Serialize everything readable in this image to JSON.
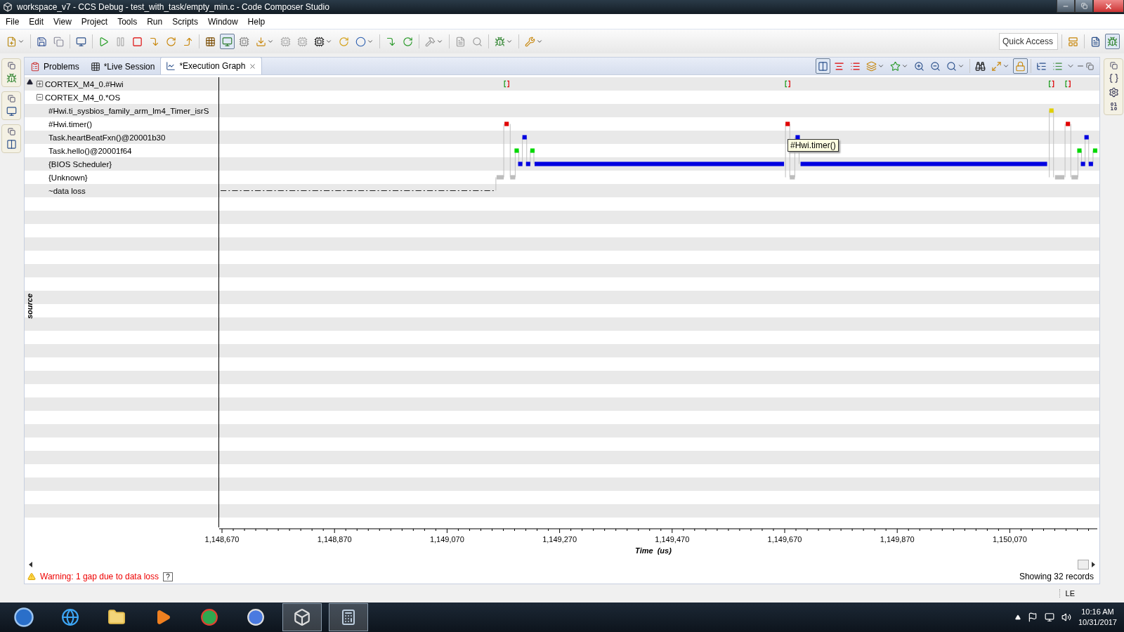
{
  "window": {
    "title": "workspace_v7 - CCS Debug - test_with_task/empty_min.c - Code Composer Studio"
  },
  "menu": [
    "File",
    "Edit",
    "View",
    "Project",
    "Tools",
    "Run",
    "Scripts",
    "Window",
    "Help"
  ],
  "quick_access": {
    "placeholder": "Quick Access"
  },
  "tabs": [
    {
      "label": "Problems",
      "selected": false,
      "kind": "problems",
      "closable": false
    },
    {
      "label": "*Live Session",
      "selected": false,
      "kind": "table",
      "closable": false
    },
    {
      "label": "*Execution Graph",
      "selected": true,
      "kind": "graph",
      "closable": true
    }
  ],
  "axis_label": "source",
  "tree": [
    {
      "label": "CORTEX_M4_0.#Hwi",
      "expanded": false
    },
    {
      "label": "CORTEX_M4_0.*OS",
      "expanded": true,
      "children": [
        {
          "label": "#Hwi.ti_sysbios_family_arm_lm4_Timer_isrS"
        },
        {
          "label": "#Hwi.timer()"
        },
        {
          "label": "Task.heartBeatFxn()@20001b30"
        },
        {
          "label": "Task.hello()@20001f64"
        },
        {
          "label": "{BIOS Scheduler}"
        },
        {
          "label": "{Unknown}"
        },
        {
          "label": "~data loss"
        }
      ]
    }
  ],
  "tooltip": "#Hwi.timer()",
  "time_axis": {
    "ticks": [
      "1,148,670",
      "1,148,870",
      "1,149,070",
      "1,149,270",
      "1,149,470",
      "1,149,670",
      "1,149,870",
      "1,150,070"
    ],
    "title": "Time  (us)"
  },
  "status": {
    "warning": "Warning: 1 gap due to data loss",
    "help": "?",
    "records": "Showing 32 records"
  },
  "status_bar": {
    "endian": "LE"
  },
  "taskbar": {
    "time": "10:16 AM",
    "date": "10/31/2017"
  }
}
